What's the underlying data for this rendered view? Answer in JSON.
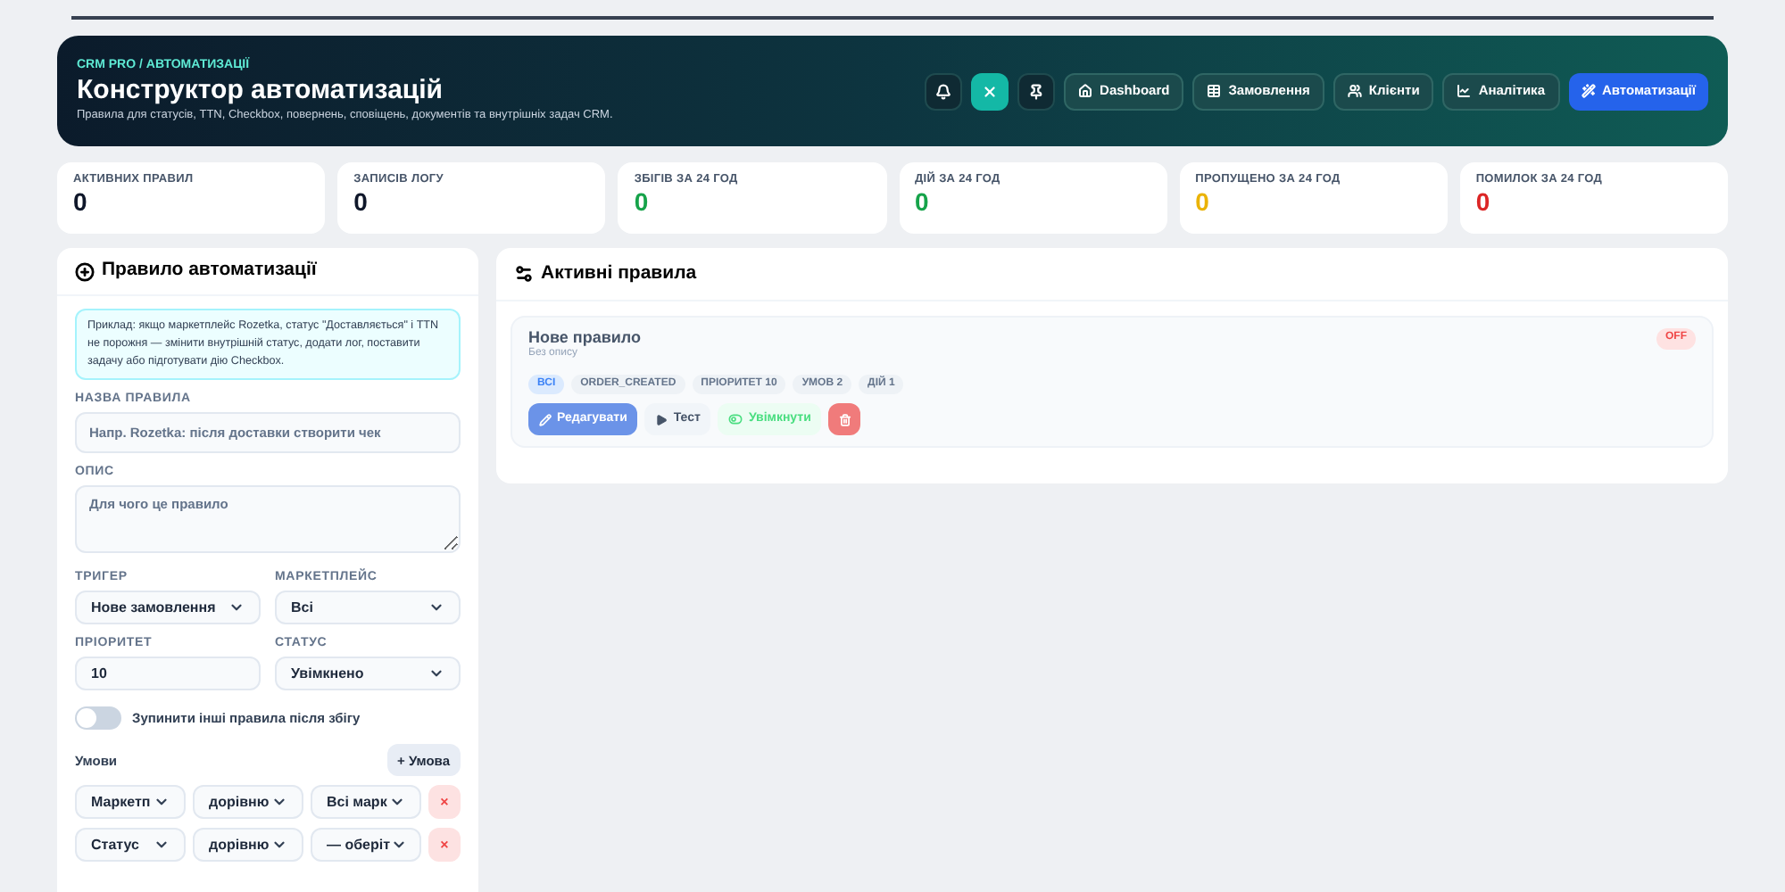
{
  "header": {
    "breadcrumb": "CRM PRO / АВТОМАТИЗАЦІЇ",
    "title": "Конструктор автоматизацій",
    "subtitle": "Правила для статусів, TTN, Checkbox, повернень, сповіщень, документів та внутрішніх задач CRM.",
    "icon_buttons": [
      {
        "kind": "bell",
        "selected": false
      },
      {
        "kind": "close",
        "selected": true
      },
      {
        "kind": "pin",
        "selected": false
      }
    ],
    "nav": [
      {
        "kind": "home",
        "label": "Dashboard",
        "selected": false
      },
      {
        "kind": "table",
        "label": "Замовлення",
        "selected": false
      },
      {
        "kind": "users",
        "label": "Клієнти",
        "selected": false
      },
      {
        "kind": "chart",
        "label": "Аналітика",
        "selected": false
      },
      {
        "kind": "wand",
        "label": "Автоматизації",
        "selected": true
      }
    ]
  },
  "stats": [
    {
      "label": "АКТИВНИХ ПРАВИЛ",
      "value": "0",
      "color": "#0f172a"
    },
    {
      "label": "ЗАПИСІВ ЛОГУ",
      "value": "0",
      "color": "#0f172a"
    },
    {
      "label": "ЗБІГІВ ЗА 24 ГОД",
      "value": "0",
      "color": "#16a34a"
    },
    {
      "label": "ДІЙ ЗА 24 ГОД",
      "value": "0",
      "color": "#16a34a"
    },
    {
      "label": "ПРОПУЩЕНО ЗА 24 ГОД",
      "value": "0",
      "color": "#eab308"
    },
    {
      "label": "ПОМИЛОК ЗА 24 ГОД",
      "value": "0",
      "color": "#dc2626"
    }
  ],
  "form": {
    "title": "Правило автоматизації",
    "hint": "Приклад: якщо маркетплейс Rozetka, статус \"Доставляється\" і TTN не порожня — змінити внутрішній статус, додати лог, поставити задачу або підготувати дію Checkbox.",
    "name_label": "НАЗВА ПРАВИЛА",
    "name_placeholder": "Напр. Rozetka: після доставки створити чек",
    "description_label": "ОПИС",
    "description_placeholder": "Для чого це правило",
    "trigger_label": "ТРИГЕР",
    "trigger_value": "Нове замовлення",
    "marketplace_label": "МАРКЕТПЛЕЙС",
    "marketplace_value": "Всі",
    "priority_label": "ПРІОРИТЕТ",
    "priority_value": "10",
    "status_label": "СТАТУС",
    "status_value": "Увімкнено",
    "stop_toggle": {
      "label": "Зупинити інші правила після збігу",
      "on": false
    },
    "conditions_label": "Умови",
    "add_condition": "+ Умова",
    "remove_symbol": "×",
    "conditions": [
      {
        "field": "Маркетп",
        "operator": "дорівню",
        "value": "Всі марк"
      },
      {
        "field": "Статус",
        "operator": "дорівню",
        "value": "— оберіт"
      }
    ]
  },
  "rules_panel": {
    "title": "Активні правила",
    "rules": [
      {
        "name": "Нове правило",
        "description": "Без опису",
        "on": false,
        "state_label": "OFF",
        "tags": [
          {
            "label": "ВСІ",
            "kind": "accent"
          },
          {
            "label": "ORDER_CREATED",
            "kind": "plain"
          },
          {
            "label": "ПРІОРИТЕТ 10",
            "kind": "plain"
          },
          {
            "label": "УМОВ 2",
            "kind": "plain"
          },
          {
            "label": "ДІЙ 1",
            "kind": "plain"
          }
        ],
        "edit": "Редагувати",
        "test": "Тест",
        "toggle": "Увімкнути"
      }
    ]
  }
}
